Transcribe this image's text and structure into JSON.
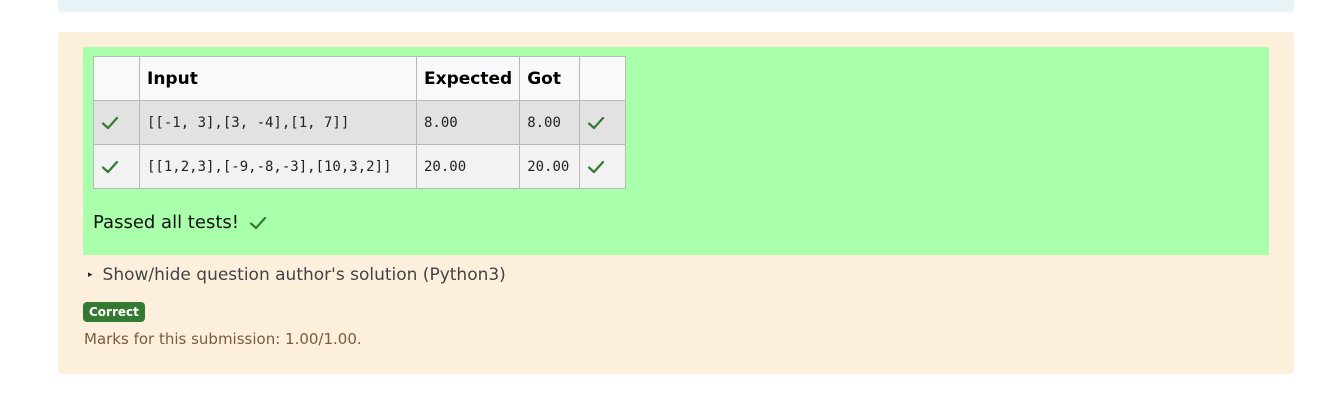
{
  "table": {
    "headers": [
      "",
      "Input",
      "Expected",
      "Got",
      ""
    ],
    "rows": [
      {
        "status_icon": "check-icon",
        "input": "[[-1, 3],[3, -4],[1, 7]]",
        "expected": "8.00",
        "got": "8.00",
        "result_icon": "check-icon"
      },
      {
        "status_icon": "check-icon",
        "input": "[[1,2,3],[-9,-8,-3],[10,3,2]]",
        "expected": "20.00",
        "got": "20.00",
        "result_icon": "check-icon"
      }
    ]
  },
  "feedback": {
    "passed_text": "Passed all tests!",
    "passed_icon": "check-icon"
  },
  "solution_toggle": {
    "label": "Show/hide question author's solution (Python3)"
  },
  "grade": {
    "badge": "Correct",
    "marks_text": "Marks for this submission: 1.00/1.00."
  },
  "colors": {
    "feedback_bg": "#aaffaa",
    "outcome_bg": "#fcefdc",
    "check_green": "#357a32",
    "badge_bg": "#357a32"
  }
}
